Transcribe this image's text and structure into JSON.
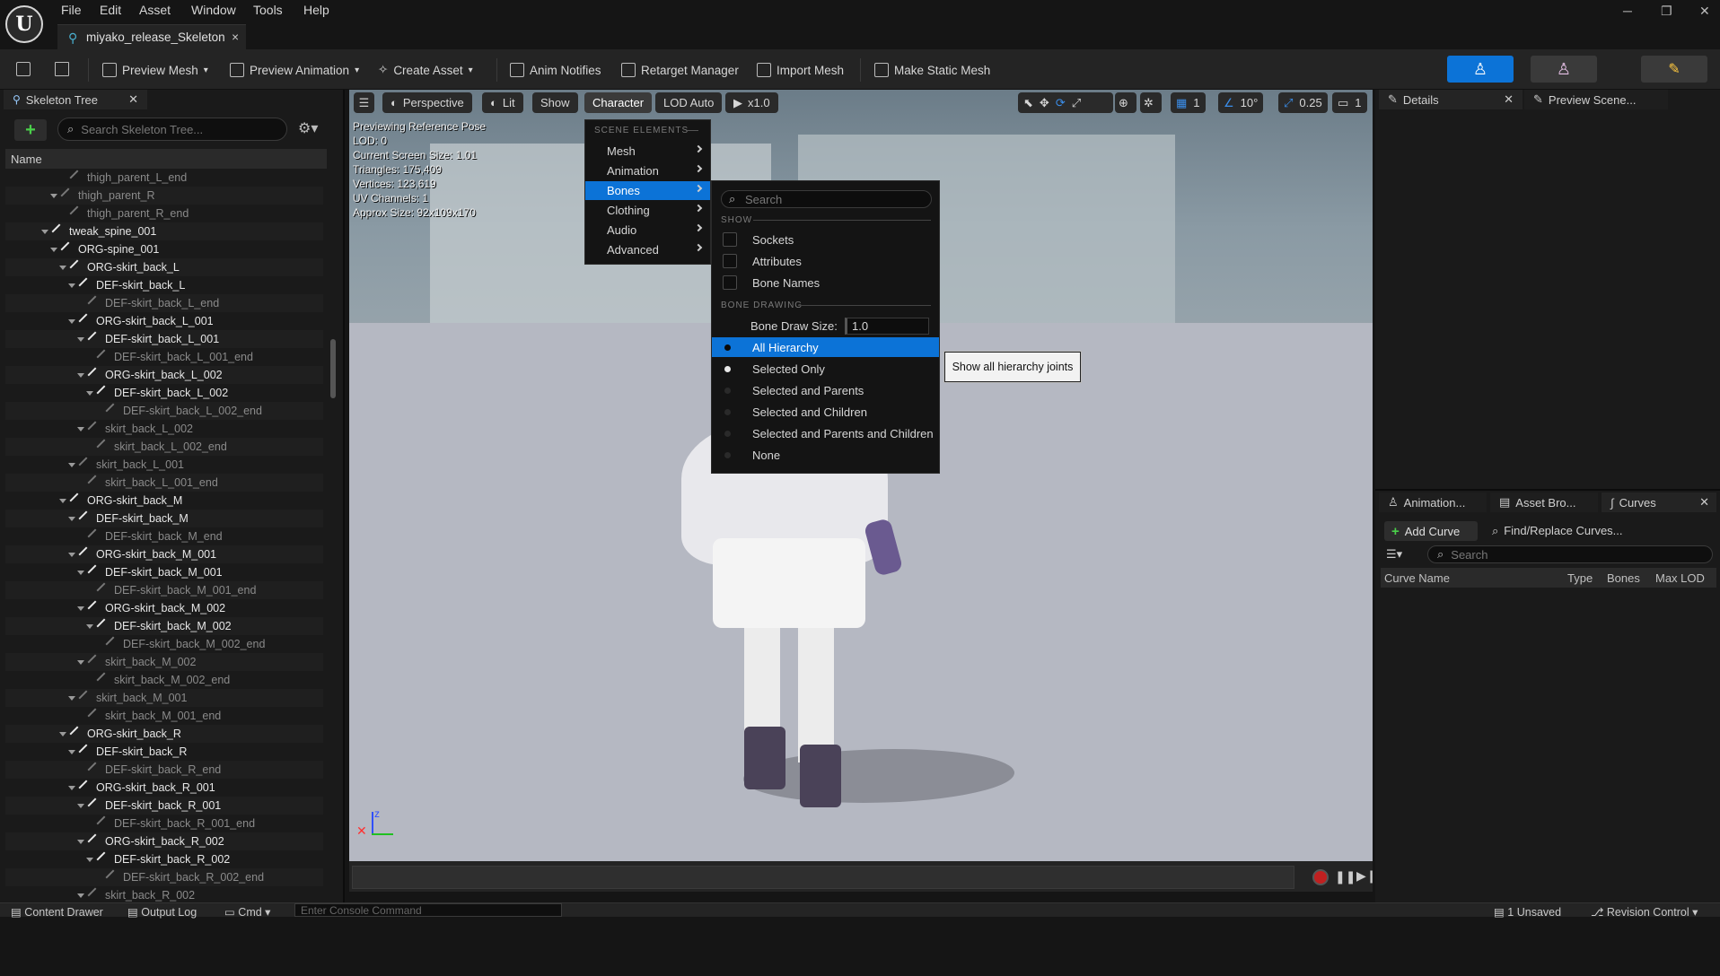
{
  "menubar": {
    "file": "File",
    "edit": "Edit",
    "asset": "Asset",
    "window": "Window",
    "tools": "Tools",
    "help": "Help"
  },
  "tab": {
    "title": "miyako_release_Skeleton",
    "close": "×"
  },
  "window_controls": {
    "minimize": "─",
    "restore": "❐",
    "close": "✕"
  },
  "toolbar": {
    "preview_mesh": "Preview Mesh",
    "preview_animation": "Preview Animation",
    "create_asset": "Create Asset",
    "anim_notifies": "Anim Notifies",
    "retarget_manager": "Retarget Manager",
    "import_mesh": "Import Mesh",
    "make_static_mesh": "Make Static Mesh",
    "accent": "#0c73d7"
  },
  "skeleton_tree": {
    "tab": "Skeleton Tree",
    "search_placeholder": "Search Skeleton Tree...",
    "column_name": "Name",
    "rows": [
      {
        "label": "thigh_parent_L_end",
        "depth": 6,
        "dim": true,
        "arrow": false
      },
      {
        "label": "thigh_parent_R",
        "depth": 5,
        "dim": true,
        "arrow": true
      },
      {
        "label": "thigh_parent_R_end",
        "depth": 6,
        "dim": true,
        "arrow": false
      },
      {
        "label": "tweak_spine_001",
        "depth": 4,
        "dim": false,
        "arrow": true
      },
      {
        "label": "ORG-spine_001",
        "depth": 5,
        "dim": false,
        "arrow": true
      },
      {
        "label": "ORG-skirt_back_L",
        "depth": 6,
        "dim": false,
        "arrow": true
      },
      {
        "label": "DEF-skirt_back_L",
        "depth": 7,
        "dim": false,
        "arrow": true
      },
      {
        "label": "DEF-skirt_back_L_end",
        "depth": 8,
        "dim": true,
        "arrow": false
      },
      {
        "label": "ORG-skirt_back_L_001",
        "depth": 7,
        "dim": false,
        "arrow": true
      },
      {
        "label": "DEF-skirt_back_L_001",
        "depth": 8,
        "dim": false,
        "arrow": true
      },
      {
        "label": "DEF-skirt_back_L_001_end",
        "depth": 9,
        "dim": true,
        "arrow": false
      },
      {
        "label": "ORG-skirt_back_L_002",
        "depth": 8,
        "dim": false,
        "arrow": true
      },
      {
        "label": "DEF-skirt_back_L_002",
        "depth": 9,
        "dim": false,
        "arrow": true
      },
      {
        "label": "DEF-skirt_back_L_002_end",
        "depth": 10,
        "dim": true,
        "arrow": false
      },
      {
        "label": "skirt_back_L_002",
        "depth": 8,
        "dim": true,
        "arrow": true
      },
      {
        "label": "skirt_back_L_002_end",
        "depth": 9,
        "dim": true,
        "arrow": false
      },
      {
        "label": "skirt_back_L_001",
        "depth": 7,
        "dim": true,
        "arrow": true
      },
      {
        "label": "skirt_back_L_001_end",
        "depth": 8,
        "dim": true,
        "arrow": false
      },
      {
        "label": "ORG-skirt_back_M",
        "depth": 6,
        "dim": false,
        "arrow": true
      },
      {
        "label": "DEF-skirt_back_M",
        "depth": 7,
        "dim": false,
        "arrow": true
      },
      {
        "label": "DEF-skirt_back_M_end",
        "depth": 8,
        "dim": true,
        "arrow": false
      },
      {
        "label": "ORG-skirt_back_M_001",
        "depth": 7,
        "dim": false,
        "arrow": true
      },
      {
        "label": "DEF-skirt_back_M_001",
        "depth": 8,
        "dim": false,
        "arrow": true
      },
      {
        "label": "DEF-skirt_back_M_001_end",
        "depth": 9,
        "dim": true,
        "arrow": false
      },
      {
        "label": "ORG-skirt_back_M_002",
        "depth": 8,
        "dim": false,
        "arrow": true
      },
      {
        "label": "DEF-skirt_back_M_002",
        "depth": 9,
        "dim": false,
        "arrow": true
      },
      {
        "label": "DEF-skirt_back_M_002_end",
        "depth": 10,
        "dim": true,
        "arrow": false
      },
      {
        "label": "skirt_back_M_002",
        "depth": 8,
        "dim": true,
        "arrow": true
      },
      {
        "label": "skirt_back_M_002_end",
        "depth": 9,
        "dim": true,
        "arrow": false
      },
      {
        "label": "skirt_back_M_001",
        "depth": 7,
        "dim": true,
        "arrow": true
      },
      {
        "label": "skirt_back_M_001_end",
        "depth": 8,
        "dim": true,
        "arrow": false
      },
      {
        "label": "ORG-skirt_back_R",
        "depth": 6,
        "dim": false,
        "arrow": true
      },
      {
        "label": "DEF-skirt_back_R",
        "depth": 7,
        "dim": false,
        "arrow": true
      },
      {
        "label": "DEF-skirt_back_R_end",
        "depth": 8,
        "dim": true,
        "arrow": false
      },
      {
        "label": "ORG-skirt_back_R_001",
        "depth": 7,
        "dim": false,
        "arrow": true
      },
      {
        "label": "DEF-skirt_back_R_001",
        "depth": 8,
        "dim": false,
        "arrow": true
      },
      {
        "label": "DEF-skirt_back_R_001_end",
        "depth": 9,
        "dim": true,
        "arrow": false
      },
      {
        "label": "ORG-skirt_back_R_002",
        "depth": 8,
        "dim": false,
        "arrow": true
      },
      {
        "label": "DEF-skirt_back_R_002",
        "depth": 9,
        "dim": false,
        "arrow": true
      },
      {
        "label": "DEF-skirt_back_R_002_end",
        "depth": 10,
        "dim": true,
        "arrow": false
      },
      {
        "label": "skirt_back_R_002",
        "depth": 8,
        "dim": true,
        "arrow": true
      }
    ]
  },
  "viewport": {
    "perspective": "Perspective",
    "lit": "Lit",
    "show": "Show",
    "character": "Character",
    "lod": "LOD Auto",
    "speed": "x1.0",
    "grid_value": "1",
    "angle_value": "10°",
    "scale_value": "0.25",
    "camera_value": "1",
    "info": {
      "line1": "Previewing Reference Pose",
      "line2": "LOD: 0",
      "line3": "Current Screen Size: 1.01",
      "line4": "Triangles: 175,409",
      "line5": "Vertices: 123,619",
      "line6": "UV Channels: 1",
      "line7": "Approx Size: 92x109x170"
    }
  },
  "character_menu": {
    "section": "SCENE ELEMENTS",
    "items": [
      "Mesh",
      "Animation",
      "Bones",
      "Clothing",
      "Audio",
      "Advanced"
    ],
    "highlighted": "Bones"
  },
  "bones_menu": {
    "search_placeholder": "Search",
    "show_section": "SHOW",
    "sockets": "Sockets",
    "attributes": "Attributes",
    "bone_names": "Bone Names",
    "bone_drawing_section": "BONE DRAWING",
    "bone_draw_size_label": "Bone Draw Size:",
    "bone_draw_size_value": "1.0",
    "options": [
      "All Hierarchy",
      "Selected Only",
      "Selected and Parents",
      "Selected and Children",
      "Selected and Parents and Children",
      "None"
    ],
    "selected": "All Hierarchy"
  },
  "tooltip": "Show all hierarchy joints",
  "right_panel": {
    "details_tab": "Details",
    "preview_scene_tab": "Preview Scene...",
    "animation_tab": "Animation...",
    "asset_browser_tab": "Asset Bro...",
    "curves_tab": "Curves",
    "add_curve": "Add Curve",
    "find_replace": "Find/Replace Curves...",
    "search_placeholder": "Search",
    "columns": [
      "Curve Name",
      "Type",
      "Bones",
      "Max LOD"
    ]
  },
  "statusbar": {
    "content_drawer": "Content Drawer",
    "output_log": "Output Log",
    "cmd": "Cmd",
    "console_placeholder": "Enter Console Command",
    "unsaved": "1 Unsaved",
    "revision_control": "Revision Control"
  }
}
